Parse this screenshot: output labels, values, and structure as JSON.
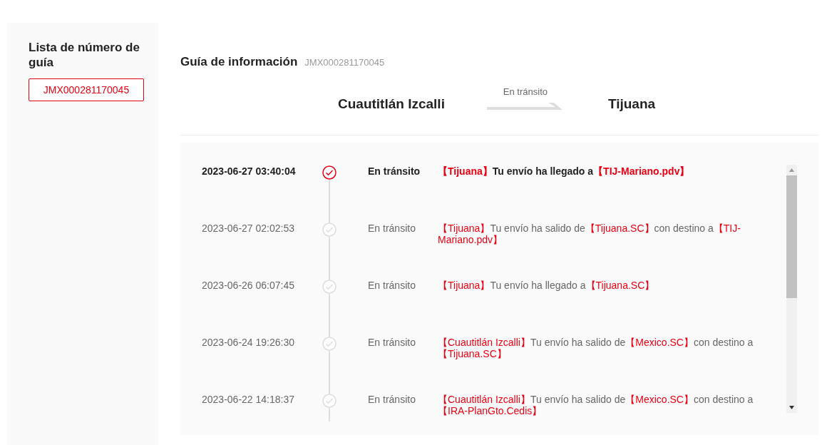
{
  "sidebar": {
    "title": "Lista de número de guía",
    "items": [
      {
        "label": "JMX000281170045",
        "selected": true
      }
    ]
  },
  "header": {
    "title": "Guía de información",
    "tracking_number": "JMX000281170045"
  },
  "route": {
    "origin": "Cuautitlán Izcalli",
    "status": "En tránsito",
    "destination": "Tijuana"
  },
  "events": [
    {
      "time": "2023-06-27 03:40:04",
      "current": true,
      "status": "En tránsito",
      "description": [
        {
          "text": "【Tijuana】",
          "highlight": true
        },
        {
          "text": "Tu envío ha llegado a",
          "highlight": false
        },
        {
          "text": "【TIJ-Mariano.pdv】",
          "highlight": true
        }
      ]
    },
    {
      "time": "2023-06-27 02:02:53",
      "current": false,
      "status": "En tránsito",
      "description": [
        {
          "text": "【Tijuana】",
          "highlight": true
        },
        {
          "text": "Tu envío ha salido de",
          "highlight": false
        },
        {
          "text": "【Tijuana.SC】",
          "highlight": true
        },
        {
          "text": "con destino a",
          "highlight": false
        },
        {
          "text": "【TIJ-Mariano.pdv】",
          "highlight": true
        }
      ]
    },
    {
      "time": "2023-06-26 06:07:45",
      "current": false,
      "status": "En tránsito",
      "description": [
        {
          "text": "【Tijuana】",
          "highlight": true
        },
        {
          "text": "Tu envío ha llegado a",
          "highlight": false
        },
        {
          "text": "【Tijuana.SC】",
          "highlight": true
        }
      ]
    },
    {
      "time": "2023-06-24 19:26:30",
      "current": false,
      "status": "En tránsito",
      "description": [
        {
          "text": "【Cuautitlán Izcalli】",
          "highlight": true
        },
        {
          "text": "Tu envío ha salido de",
          "highlight": false
        },
        {
          "text": "【Mexico.SC】",
          "highlight": true
        },
        {
          "text": "con destino a",
          "highlight": false
        },
        {
          "text": "【Tijuana.SC】",
          "highlight": true
        }
      ]
    },
    {
      "time": "2023-06-22 14:18:37",
      "current": false,
      "status": "En tránsito",
      "description": [
        {
          "text": "【Cuautitlán Izcalli】",
          "highlight": true
        },
        {
          "text": "Tu envío ha salido de",
          "highlight": false
        },
        {
          "text": "【Mexico.SC】",
          "highlight": true
        },
        {
          "text": "con destino a",
          "highlight": false
        },
        {
          "text": "【IRA-PlanGto.Cedis】",
          "highlight": true
        }
      ]
    }
  ]
}
